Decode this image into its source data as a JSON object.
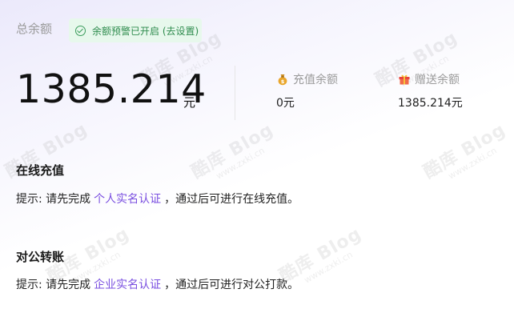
{
  "balance": {
    "label": "总余额",
    "alert_chip": {
      "icon": "check-circle-icon",
      "text": "余额预警已开启 (去设置)",
      "color": "#2f8c4e"
    },
    "amount": "1385.214",
    "unit": "元"
  },
  "sub_balances": [
    {
      "icon": "money-bag-icon",
      "label": "充值余额",
      "value": "0元"
    },
    {
      "icon": "gift-icon",
      "label": "赠送余额",
      "value": "1385.214元"
    }
  ],
  "online_recharge": {
    "title": "在线充值",
    "hint_prefix": "提示: 请先完成",
    "link": "个人实名认证",
    "hint_suffix": "，通过后可进行在线充值。"
  },
  "corporate_transfer": {
    "title": "对公转账",
    "hint_prefix": "提示: 请先完成",
    "link": "企业实名认证",
    "hint_suffix": "，通过后可进行对公打款。"
  },
  "watermark": {
    "brand": "酷库 Blog",
    "url": "www.zxki.cn"
  },
  "colors": {
    "accent_link": "#7a4fe0",
    "chip_bg": "#e7f8ec"
  }
}
